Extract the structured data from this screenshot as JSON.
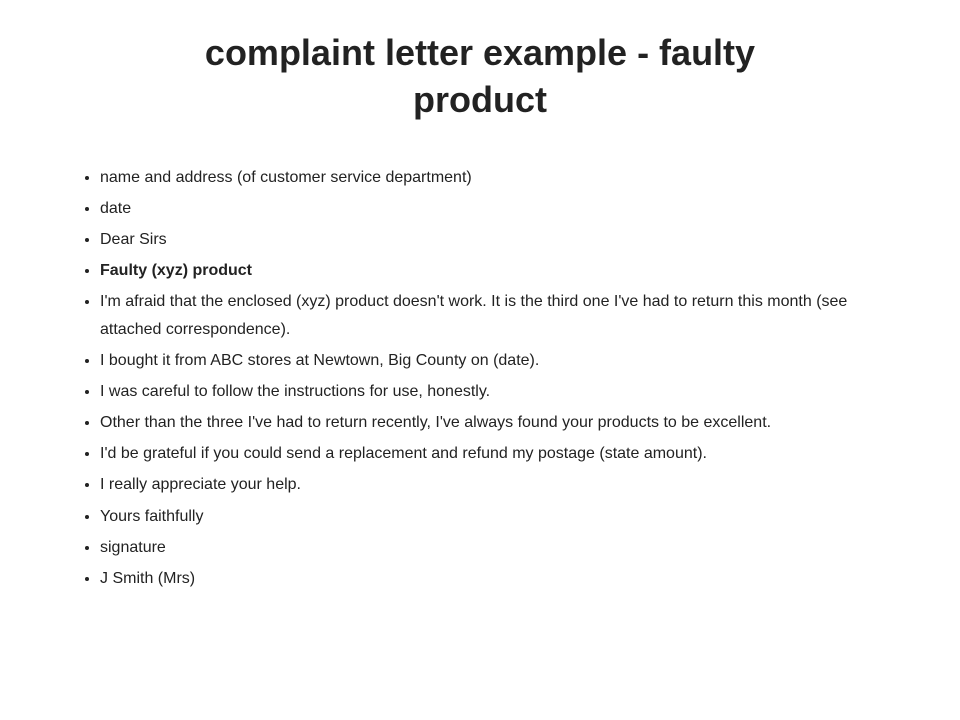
{
  "page": {
    "title_line1": "complaint letter example - faulty",
    "title_line2": "product"
  },
  "letter": {
    "items": [
      {
        "text": "name and address (of customer service department)",
        "bold": false
      },
      {
        "text": "date",
        "bold": false
      },
      {
        "text": "Dear Sirs",
        "bold": false
      },
      {
        "text": "Faulty (xyz) product",
        "bold": true
      },
      {
        "text": "I'm afraid that the enclosed (xyz) product doesn't work. It is the third one I've had to return this month (see attached correspondence).",
        "bold": false
      },
      {
        "text": "I bought it from ABC stores at Newtown, Big County on (date).",
        "bold": false
      },
      {
        "text": "I was careful to follow the instructions for use, honestly.",
        "bold": false
      },
      {
        "text": "Other than the three I've had to return recently, I've always found your products to be excellent.",
        "bold": false
      },
      {
        "text": "I'd be grateful if you could send a replacement and refund my postage (state amount).",
        "bold": false
      },
      {
        "text": "I really appreciate your help.",
        "bold": false
      },
      {
        "text": "Yours faithfully",
        "bold": false
      },
      {
        "text": "signature",
        "bold": false
      },
      {
        "text": "J Smith (Mrs)",
        "bold": false
      }
    ]
  }
}
